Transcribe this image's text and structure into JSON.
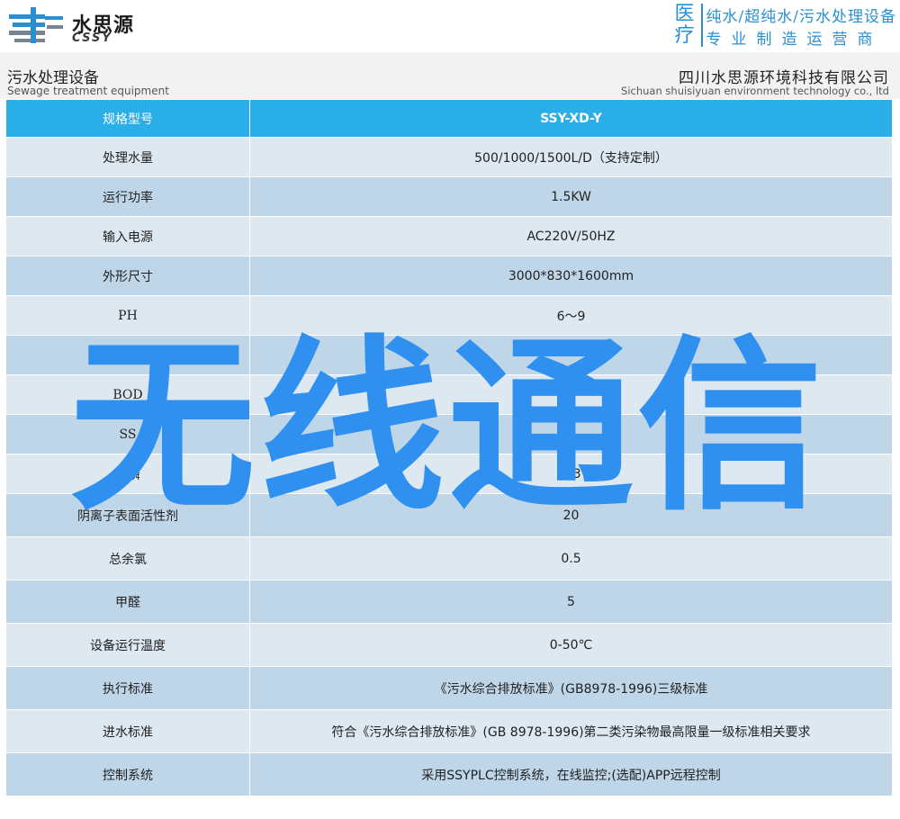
{
  "header": {
    "brand_cn": "水思源",
    "brand_en": "CSSY",
    "slogan_side": [
      "医",
      "疗"
    ],
    "slogan_line1": "纯水/超纯水/污水处理设备",
    "slogan_line2": "专业制造运营商"
  },
  "subheader": {
    "left_cn": "污水处理设备",
    "left_en": "Sewage treatment equipment",
    "right_cn": "四川水思源环境科技有限公司",
    "right_en": "Sichuan shuisiyuan environment technology co., ltd"
  },
  "spec_table": {
    "rows": [
      {
        "key": "规格型号",
        "value": "SSY-XD-Y"
      },
      {
        "key": "处理水量",
        "value": "500/1000/1500L/D（支持定制）"
      },
      {
        "key": "运行功率",
        "value": "1.5KW"
      },
      {
        "key": "输入电源",
        "value": "AC220V/50HZ"
      },
      {
        "key": "外形尺寸",
        "value": "3000*830*1600mm"
      },
      {
        "key": "PH",
        "value": "6～9"
      },
      {
        "key": "COD",
        "value": ""
      },
      {
        "key": "BOD",
        "value": ""
      },
      {
        "key": "SS",
        "value": "4"
      },
      {
        "key": "总磷",
        "value": "0.3"
      },
      {
        "key": "阴离子表面活性剂",
        "value": "20"
      },
      {
        "key": "总余氯",
        "value": "0.5"
      },
      {
        "key": "甲醛",
        "value": "5"
      },
      {
        "key": "设备运行温度",
        "value": "0-50℃"
      },
      {
        "key": "执行标准",
        "value": "《污水综合排放标准》(GB8978-1996)三级标准"
      },
      {
        "key": "进水标准",
        "value": "符合《污水综合排放标准》(GB 8978-1996)第二类污染物最高限量一级标准相关要求"
      },
      {
        "key": "控制系统",
        "value": "采用SSYPLC控制系统，在线监控;(选配)APP远程控制"
      }
    ]
  },
  "watermark": {
    "text": "无线通信",
    "color": "#2f90f0"
  },
  "colors": {
    "header_row": "#2aaee8",
    "row_light": "#dde8f1",
    "row_dark": "#bfd6e8",
    "accent": "#2a8fd0"
  }
}
